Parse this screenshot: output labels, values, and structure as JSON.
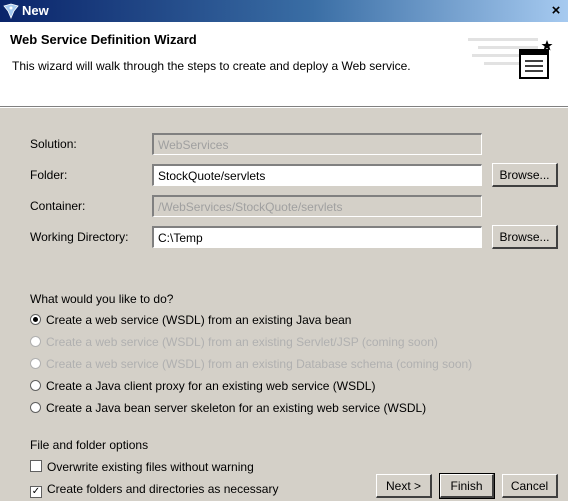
{
  "window": {
    "title": "New"
  },
  "banner": {
    "title": "Web Service Definition Wizard",
    "description": "This wizard will walk through the steps to create and deploy a Web service."
  },
  "form": {
    "solution": {
      "label": "Solution:",
      "value": "WebServices"
    },
    "folder": {
      "label": "Folder:",
      "value": "StockQuote/servlets",
      "browse_label": "Browse..."
    },
    "container": {
      "label": "Container:",
      "value": "/WebServices/StockQuote/servlets"
    },
    "working_directory": {
      "label": "Working Directory:",
      "value": "C:\\Temp",
      "browse_label": "Browse..."
    }
  },
  "options": {
    "question": "What would you like to do?",
    "items": [
      {
        "label": "Create a web service (WSDL) from an existing Java bean",
        "selected": true,
        "enabled": true
      },
      {
        "label": "Create a web service (WSDL) from an existing Servlet/JSP (coming soon)",
        "selected": false,
        "enabled": false
      },
      {
        "label": "Create a web service (WSDL) from an existing Database schema (coming soon)",
        "selected": false,
        "enabled": false
      },
      {
        "label": "Create a Java client proxy for an existing web service (WSDL)",
        "selected": false,
        "enabled": true
      },
      {
        "label": "Create a Java bean server skeleton for an existing web service (WSDL)",
        "selected": false,
        "enabled": true
      }
    ]
  },
  "file_options": {
    "title": "File and folder options",
    "overwrite": {
      "label": "Overwrite existing files without warning",
      "checked": false
    },
    "create_folders": {
      "label": "Create folders and directories as necessary",
      "checked": true
    }
  },
  "buttons": {
    "next": "Next >",
    "finish": "Finish",
    "cancel": "Cancel"
  }
}
